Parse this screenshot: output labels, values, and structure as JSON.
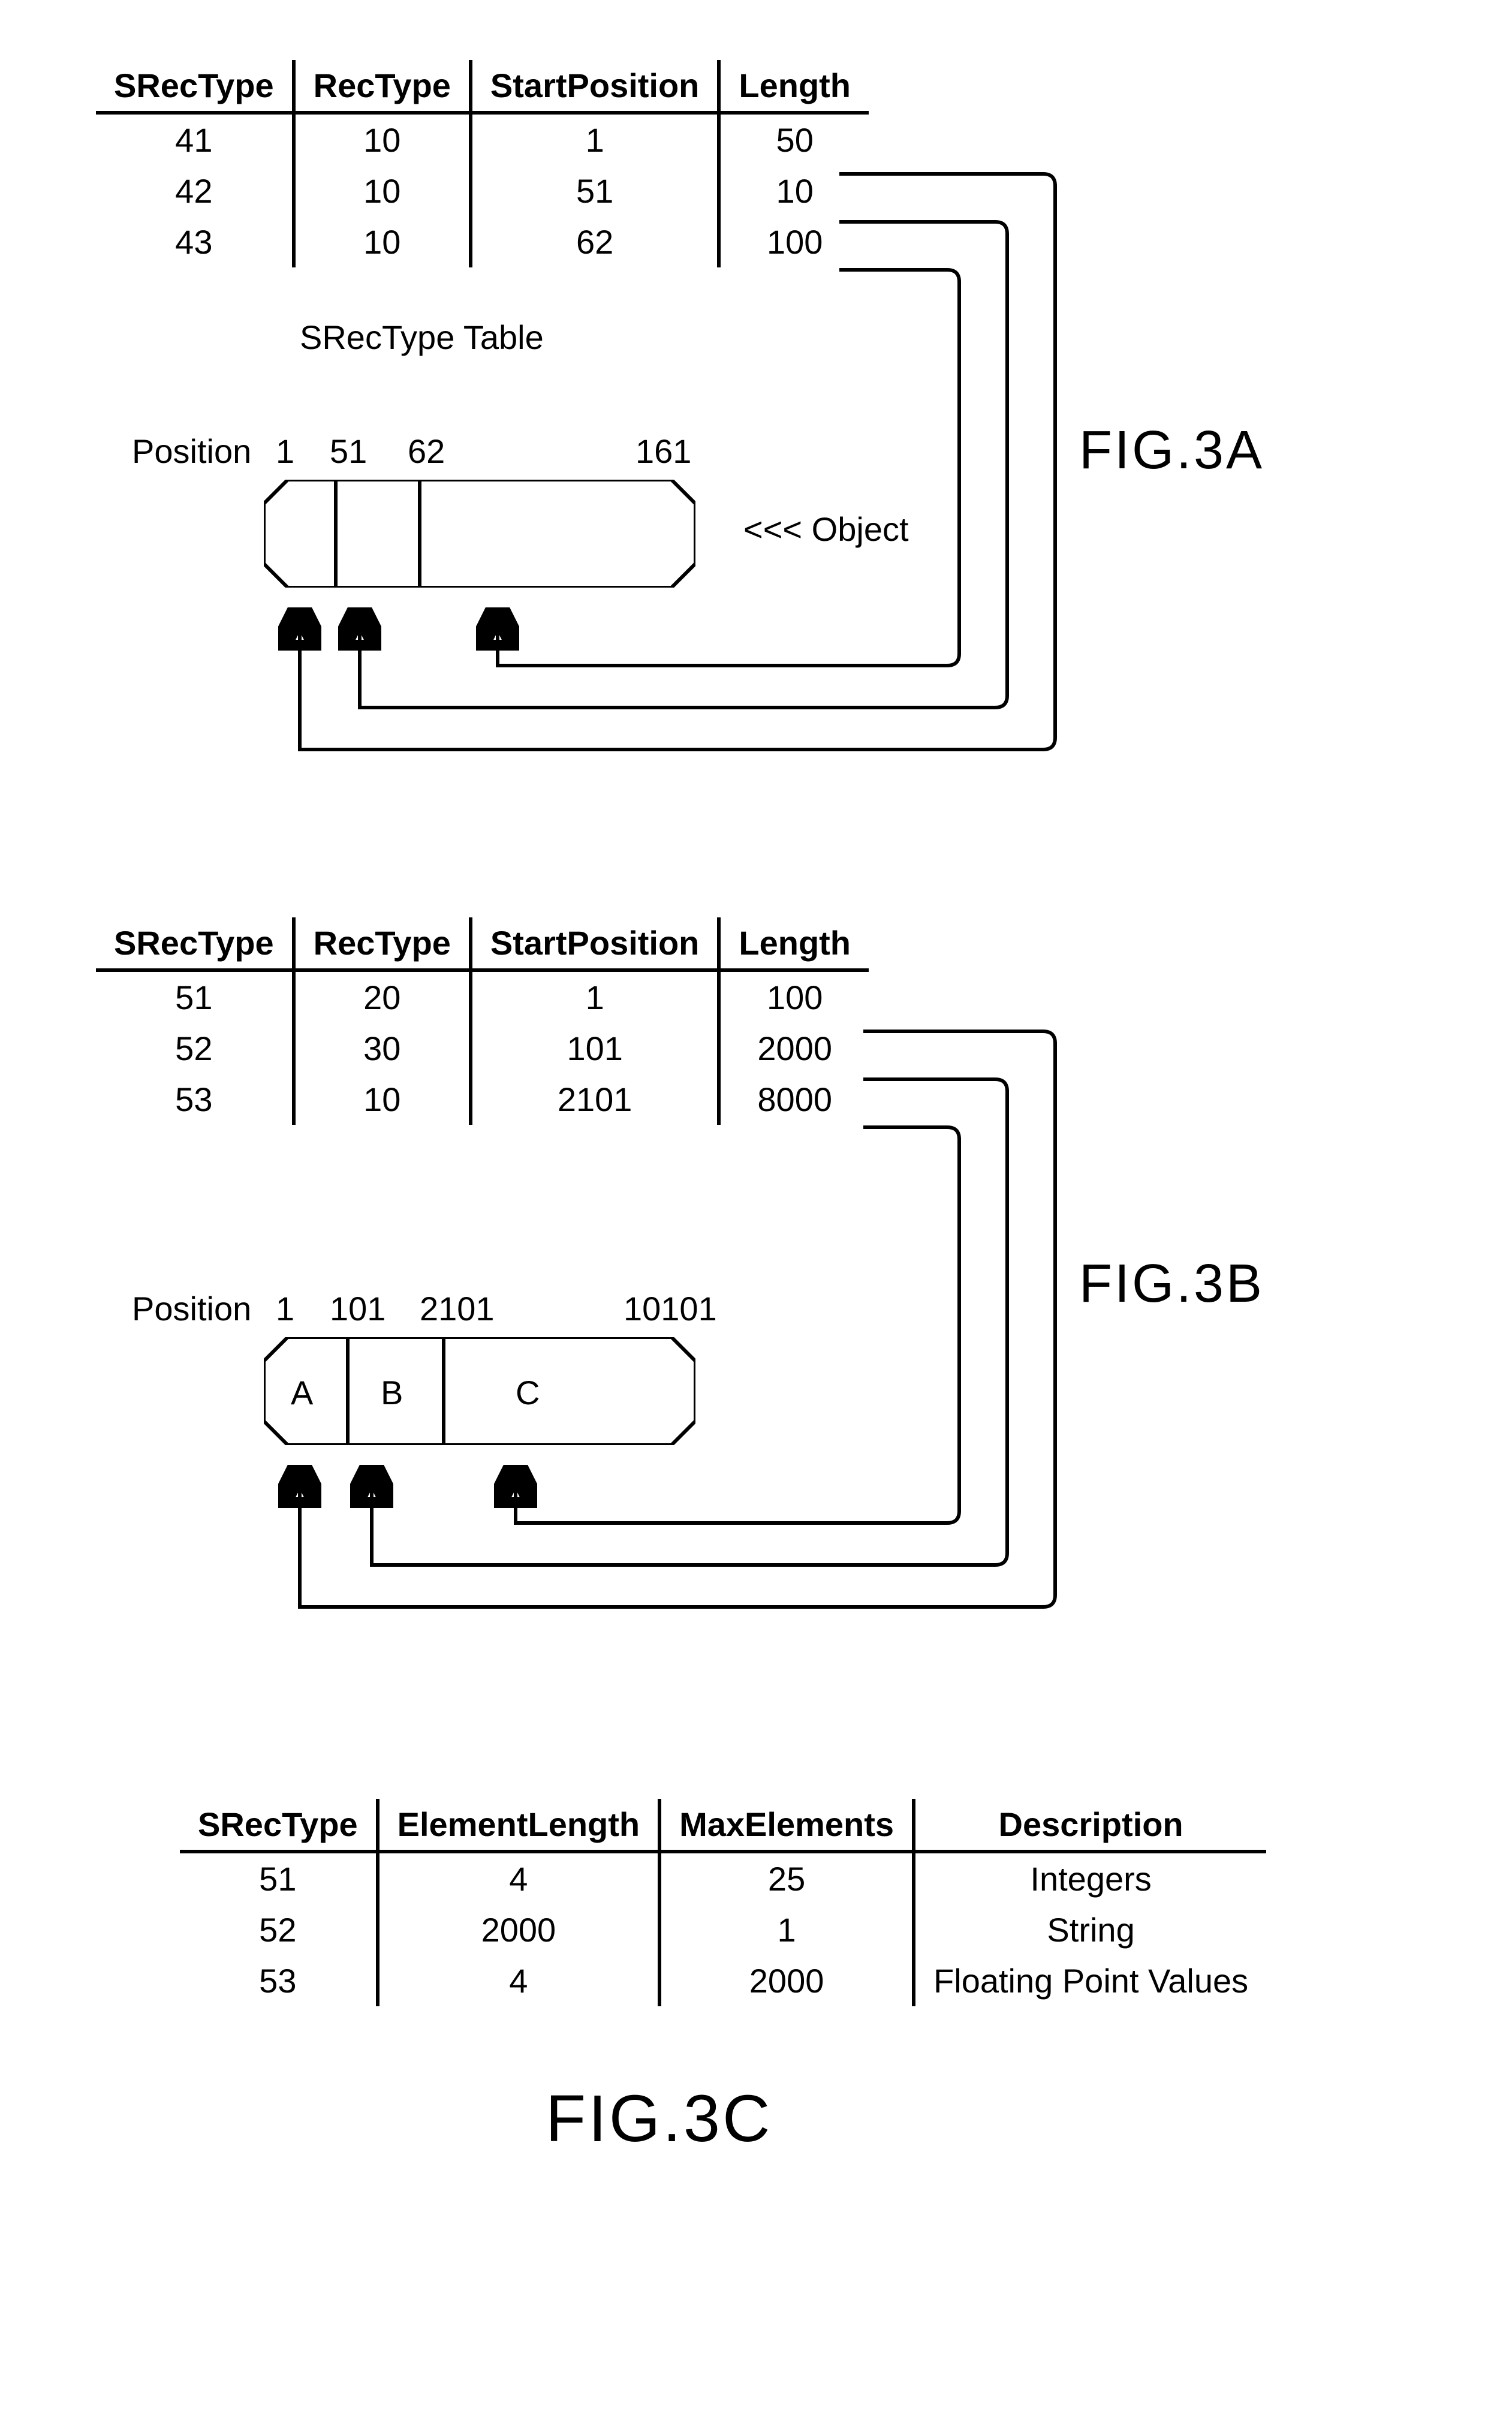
{
  "figA": {
    "label": "FIG.3A",
    "table": {
      "headers": [
        "SRecType",
        "RecType",
        "StartPosition",
        "Length"
      ],
      "rows": [
        [
          "41",
          "10",
          "1",
          "50"
        ],
        [
          "42",
          "10",
          "51",
          "10"
        ],
        [
          "43",
          "10",
          "62",
          "100"
        ]
      ],
      "caption": "SRecType Table"
    },
    "positions_word": "Position",
    "positions": [
      "1",
      "51",
      "62",
      "161"
    ],
    "object_label": "<<< Object",
    "segments": [
      "",
      "",
      ""
    ]
  },
  "figB": {
    "label": "FIG.3B",
    "table": {
      "headers": [
        "SRecType",
        "RecType",
        "StartPosition",
        "Length"
      ],
      "rows": [
        [
          "51",
          "20",
          "1",
          "100"
        ],
        [
          "52",
          "30",
          "101",
          "2000"
        ],
        [
          "53",
          "10",
          "2101",
          "8000"
        ]
      ]
    },
    "positions_word": "Position",
    "positions": [
      "1",
      "101",
      "2101",
      "10101"
    ],
    "segments": [
      "A",
      "B",
      "C"
    ]
  },
  "figC": {
    "label": "FIG.3C",
    "table": {
      "headers": [
        "SRecType",
        "ElementLength",
        "MaxElements",
        "Description"
      ],
      "rows": [
        [
          "51",
          "4",
          "25",
          "Integers"
        ],
        [
          "52",
          "2000",
          "1",
          "String"
        ],
        [
          "53",
          "4",
          "2000",
          "Floating Point Values"
        ]
      ]
    }
  }
}
